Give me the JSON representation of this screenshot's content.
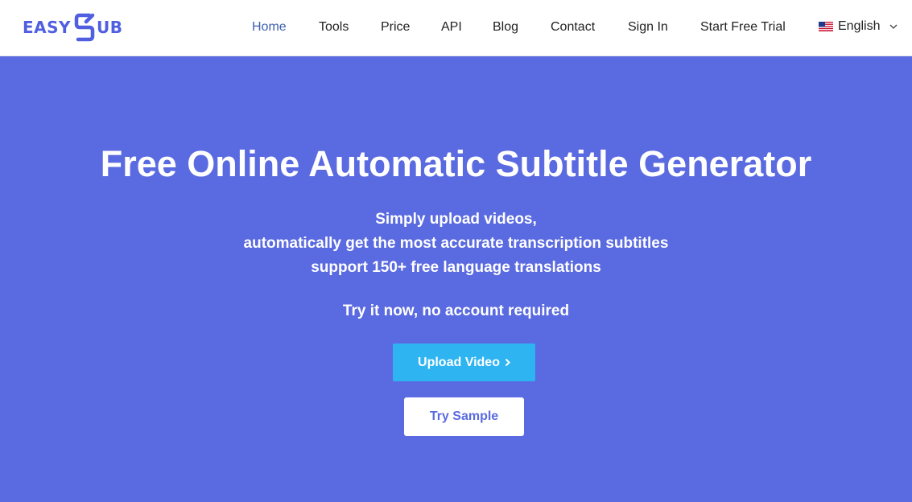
{
  "brand": {
    "logo_left": "EASY",
    "logo_right": "UB",
    "accent_color": "#4f5fe0"
  },
  "nav": {
    "items": [
      {
        "label": "Home",
        "active": true
      },
      {
        "label": "Tools"
      },
      {
        "label": "Price"
      },
      {
        "label": "API"
      },
      {
        "label": "Blog"
      },
      {
        "label": "Contact"
      },
      {
        "label": "Sign In"
      },
      {
        "label": "Start Free Trial"
      }
    ],
    "language": {
      "label": "English",
      "flag_icon": "us-flag-icon",
      "dropdown_icon": "chevron-down-icon"
    }
  },
  "hero": {
    "background_color": "#5a6ae0",
    "title": "Free Online Automatic Subtitle Generator",
    "lines": [
      "Simply upload videos,",
      "automatically get the most accurate transcription subtitles",
      "support 150+ free language translations"
    ],
    "cta_note": "Try it now, no account required",
    "upload_button": "Upload Video",
    "upload_button_color": "#2fb4f2",
    "sample_button": "Try Sample"
  }
}
